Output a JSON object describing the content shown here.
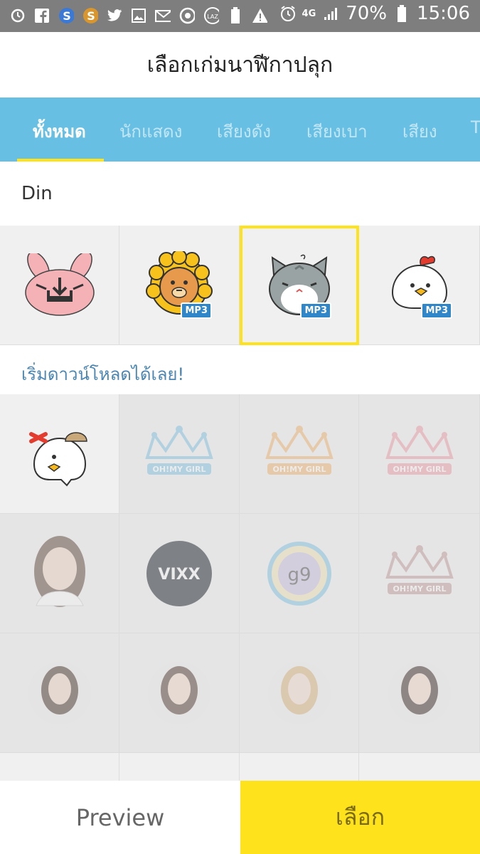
{
  "status_bar": {
    "battery": "70%",
    "time": "15:06",
    "network": "4G",
    "icons": [
      "alarm-icon",
      "facebook-icon",
      "skype-icon",
      "s-app-icon",
      "twitter-icon",
      "gallery-icon",
      "mail-icon",
      "sync-icon",
      "lazada-icon",
      "battery-saver-icon",
      "warning-icon"
    ]
  },
  "header": {
    "title": "เลือกเก่มนาฬีกาปลุก"
  },
  "tabs": [
    {
      "label": "ทั้งหมด",
      "active": true
    },
    {
      "label": "นักแสดง",
      "active": false
    },
    {
      "label": "เสียงดัง",
      "active": false
    },
    {
      "label": "เสียงเบา",
      "active": false
    },
    {
      "label": "เสียง",
      "active": false
    },
    {
      "label": "T",
      "active": false
    }
  ],
  "sections": {
    "downloaded_label": "Din",
    "start_download_label": "เริ่มดาวน์โหลดได้เลย!"
  },
  "downloaded_items": [
    {
      "name": "pink-bunny-download",
      "badge": ""
    },
    {
      "name": "lion",
      "badge": "MP3"
    },
    {
      "name": "gray-cat",
      "badge": "MP3",
      "selected": true
    },
    {
      "name": "white-chick",
      "badge": "MP3"
    }
  ],
  "available_items": [
    {
      "name": "chick-detective",
      "text": ""
    },
    {
      "name": "ohmygirl-crown-blue",
      "text": "OH!MY GIRL"
    },
    {
      "name": "ohmygirl-crown-orange",
      "text": "OH!MY GIRL"
    },
    {
      "name": "ohmygirl-crown-pink",
      "text": "OH!MY GIRL"
    },
    {
      "name": "portrait-girl-1",
      "text": ""
    },
    {
      "name": "vixx-logo",
      "text": "VIXX"
    },
    {
      "name": "gugudan-logo",
      "text": "g9"
    },
    {
      "name": "ohmygirl-crown-dark",
      "text": "OH!MY GIRL"
    },
    {
      "name": "portrait-girl-2",
      "text": ""
    },
    {
      "name": "portrait-girl-3",
      "text": ""
    },
    {
      "name": "portrait-girl-4",
      "text": ""
    },
    {
      "name": "portrait-girl-5",
      "text": ""
    }
  ],
  "buttons": {
    "preview": "Preview",
    "select": "เลือก"
  },
  "colors": {
    "accent_yellow": "#fde21c",
    "tab_blue": "#67c0e4",
    "mp3_blue": "#2f86c8"
  }
}
